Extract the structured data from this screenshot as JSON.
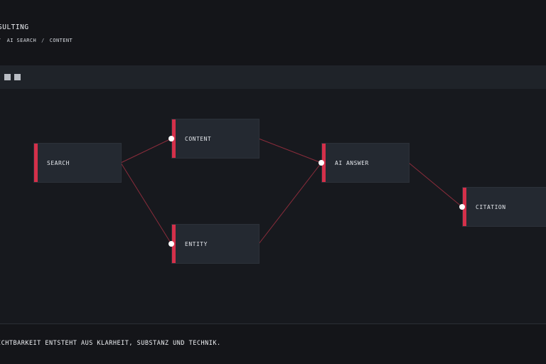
{
  "header": {
    "brand": "SULTING",
    "breadcrumb": {
      "lead": "/",
      "items": [
        "AI SEARCH",
        "CONTENT"
      ],
      "separator": "/"
    }
  },
  "toolbar": {
    "buttons": [
      "toolbar-square",
      "toolbar-square"
    ]
  },
  "diagram": {
    "nodes": [
      {
        "id": "search",
        "label": "SEARCH"
      },
      {
        "id": "content",
        "label": "CONTENT"
      },
      {
        "id": "entity",
        "label": "ENTITY"
      },
      {
        "id": "ai_answer",
        "label": "AI ANSWER"
      },
      {
        "id": "citation",
        "label": "CITATION"
      }
    ],
    "edges": [
      {
        "from": "search",
        "to": "content"
      },
      {
        "from": "search",
        "to": "entity"
      },
      {
        "from": "content",
        "to": "ai_answer"
      },
      {
        "from": "entity",
        "to": "ai_answer"
      },
      {
        "from": "ai_answer",
        "to": "citation"
      }
    ],
    "colors": {
      "accent": "#d4304a",
      "edge": "#8a2c3b",
      "node_bg": "#242931",
      "port": "#ffffff"
    }
  },
  "footer": {
    "tagline": "ICHTBARKEIT ENTSTEHT AUS KLARHEIT, SUBSTANZ UND TECHNIK."
  }
}
